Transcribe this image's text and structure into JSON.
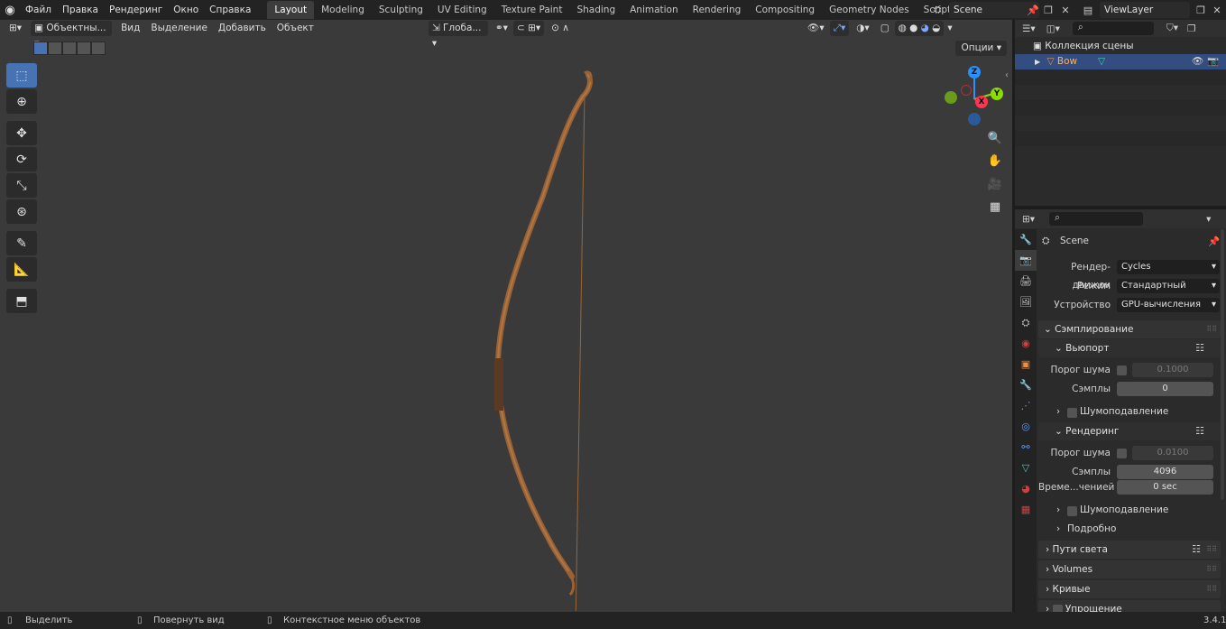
{
  "menu": [
    "Файл",
    "Правка",
    "Рендеринг",
    "Окно",
    "Справка"
  ],
  "workspaces": [
    "Layout",
    "Modeling",
    "Sculpting",
    "UV Editing",
    "Texture Paint",
    "Shading",
    "Animation",
    "Rendering",
    "Compositing",
    "Geometry Nodes",
    "Scripting"
  ],
  "active_workspace": "Layout",
  "scene_name": "Scene",
  "view_layer": "ViewLayer",
  "viewport": {
    "mode": "Объектны...",
    "menus": [
      "Вид",
      "Выделение",
      "Добавить",
      "Объект"
    ],
    "orientation": "Глоба...",
    "options": "Опции",
    "axes": {
      "x": "X",
      "y": "Y",
      "z": "Z"
    }
  },
  "outliner": {
    "collection": "Коллекция сцены",
    "object": "Bow"
  },
  "properties": {
    "scene_title": "Scene",
    "render_engine_label": "Рендер-движок",
    "render_engine": "Cycles",
    "mode_label": "Режим",
    "mode": "Стандартный",
    "device_label": "Устройство",
    "device": "GPU-вычисления",
    "sampling": "Сэмплирование",
    "viewport_sub": "Вьюпорт",
    "noise_threshold_label": "Порог шума",
    "viewport_noise": "0.1000",
    "samples_label": "Сэмплы",
    "viewport_samples": "0",
    "denoise": "Шумоподавление",
    "render_sub": "Рендеринг",
    "render_noise": "0.0100",
    "render_samples": "4096",
    "time_limit_label": "Време...ченией",
    "time_limit": "0 sec",
    "details": "Подробно",
    "light_paths": "Пути света",
    "volumes": "Volumes",
    "curves": "Кривые",
    "simplify": "Упрощение"
  },
  "status": {
    "select": "Выделить",
    "rotate": "Повернуть вид",
    "context": "Контекстное меню объектов",
    "version": "3.4.1"
  },
  "colors": {
    "accent": "#4772b3",
    "selected_row": "#334d80",
    "x_axis": "#ff3352",
    "y_axis": "#8bdc00",
    "z_axis": "#2890ff"
  }
}
